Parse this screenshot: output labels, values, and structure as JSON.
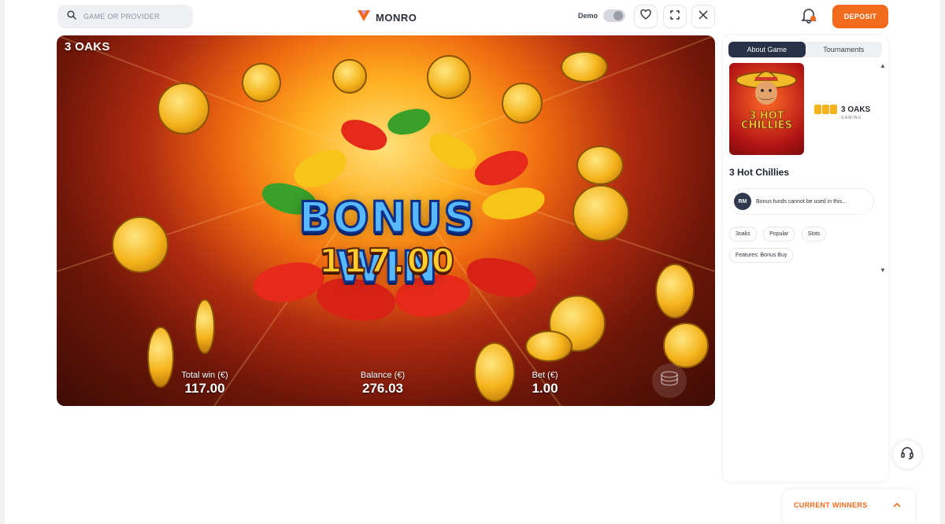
{
  "header": {
    "search_placeholder": "GAME OR PROVIDER",
    "logo_text": "MONRO",
    "demo_label": "Demo",
    "deposit_label": "DEPOSIT"
  },
  "game": {
    "provider_tag": "3 OAKS",
    "bonus_title": "BONUS WIN",
    "bonus_amount": "117.00",
    "total_win_label": "Total win (€)",
    "total_win_value": "117.00",
    "balance_label": "Balance (€)",
    "balance_value": "276.03",
    "bet_label": "Bet (€)",
    "bet_value": "1.00"
  },
  "panel": {
    "tabs": [
      {
        "label": "About Game",
        "active": true
      },
      {
        "label": "Tournaments",
        "active": false
      }
    ],
    "thumb_text": "3 HOT CHILLIES",
    "provider_name": "3 OAKS",
    "provider_sub": "GAMING",
    "game_name": "3 Hot Chillies",
    "notice_avatar": "RM",
    "notice_text": "Bonus funds cannot be used in this...",
    "tags": [
      "3oaks",
      "Popular",
      "Slots",
      "Features: Bonus Buy"
    ]
  },
  "footer": {
    "winners_label": "CURRENT WINNERS"
  },
  "colors": {
    "accent": "#f26a1b",
    "tab_active": "#273248"
  }
}
